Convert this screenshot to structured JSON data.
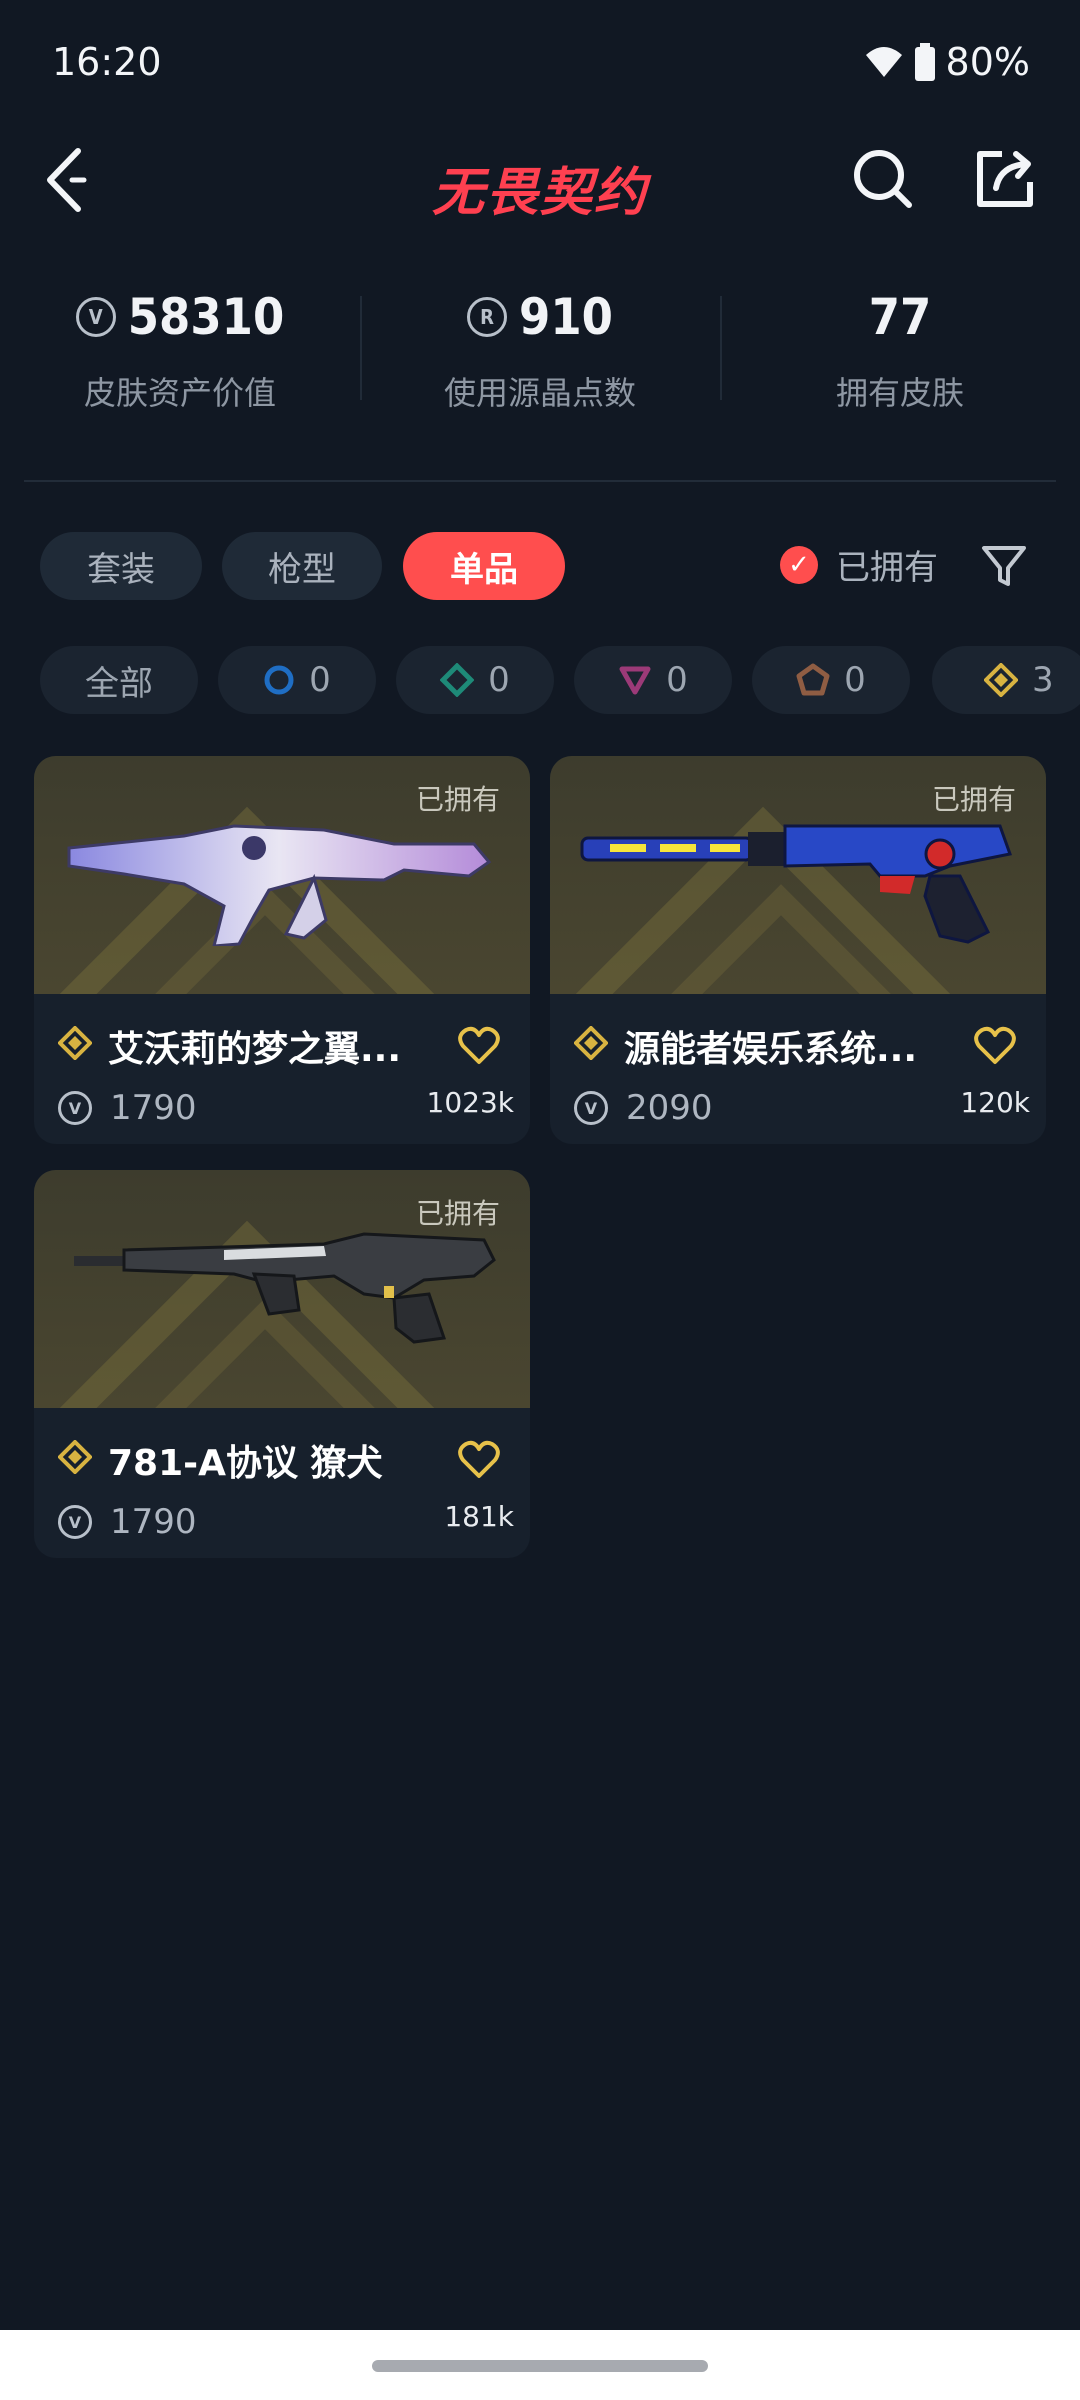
{
  "status": {
    "time": "16:20",
    "battery": "80%"
  },
  "header": {
    "title": "无畏契约"
  },
  "stats": [
    {
      "value": "58310",
      "label": "皮肤资产价值",
      "icon": "vp-coin-icon"
    },
    {
      "value": "910",
      "label": "使用源晶点数",
      "icon": "radianite-icon"
    },
    {
      "value": "77",
      "label": "拥有皮肤",
      "icon": ""
    }
  ],
  "tabs": [
    {
      "label": "套装",
      "active": false
    },
    {
      "label": "枪型",
      "active": false
    },
    {
      "label": "单品",
      "active": true
    }
  ],
  "owned_filter": {
    "label": "已拥有",
    "checked": true
  },
  "rarity_chips": [
    {
      "label": "全部"
    },
    {
      "count": "0",
      "icon": "select-tier-icon",
      "color": "#1f6ec4"
    },
    {
      "count": "0",
      "icon": "deluxe-tier-icon",
      "color": "#1e8a78"
    },
    {
      "count": "0",
      "icon": "premium-tier-icon",
      "color": "#9c3a78"
    },
    {
      "count": "0",
      "icon": "exclusive-tier-icon",
      "color": "#8f5d43"
    },
    {
      "count": "3",
      "icon": "ultra-tier-icon",
      "color": "#d8b341"
    }
  ],
  "cards": [
    {
      "name": "艾沃莉的梦之翼...",
      "price": "1790",
      "likes": "1023k",
      "owned_tag": "已拥有"
    },
    {
      "name": "源能者娱乐系统...",
      "price": "2090",
      "likes": "120k",
      "owned_tag": "已拥有"
    },
    {
      "name": "781-A协议 獠犬",
      "price": "1790",
      "likes": "181k",
      "owned_tag": "已拥有"
    }
  ],
  "colors": {
    "accent": "#ff4e4e",
    "background": "#111823",
    "rarity_gold": "#d8b341"
  }
}
